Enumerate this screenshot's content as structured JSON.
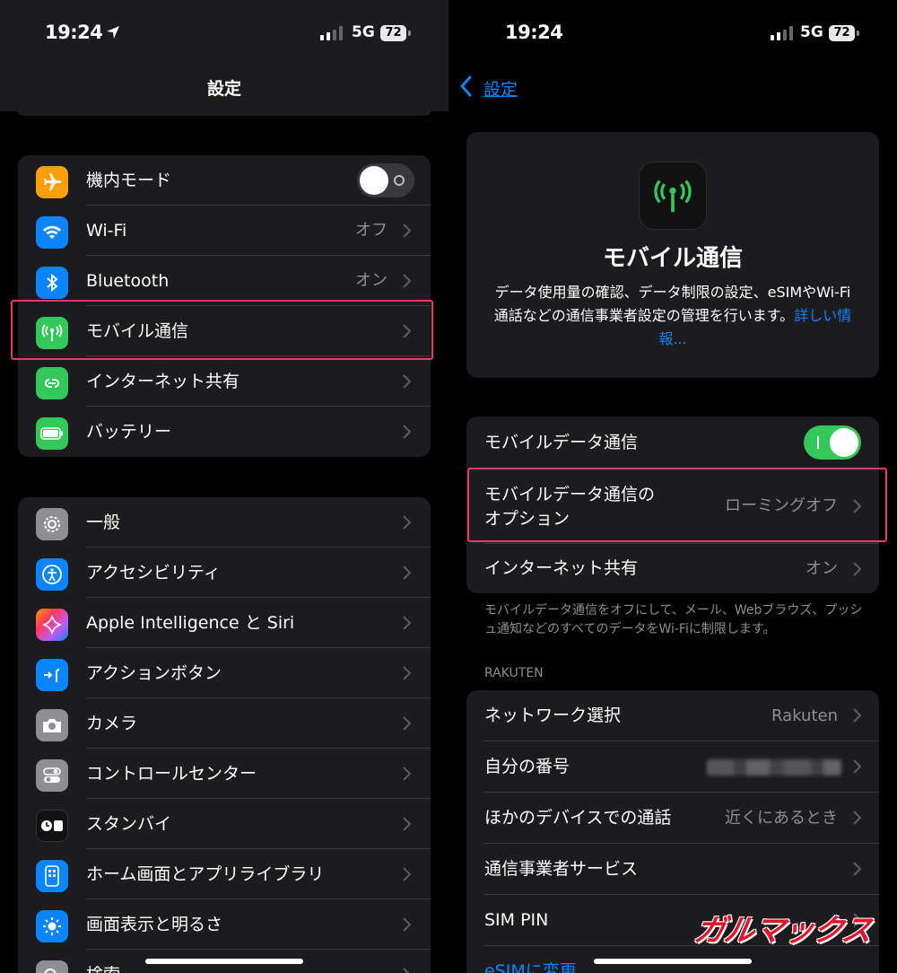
{
  "left": {
    "status": {
      "time": "19:24",
      "network": "5G",
      "battery": "72"
    },
    "nav_title": "設定",
    "group1": [
      {
        "label": "機内モード",
        "icon": "airplane-icon",
        "type": "toggle",
        "on": false
      },
      {
        "label": "Wi-Fi",
        "icon": "wifi-icon",
        "value": "オフ"
      },
      {
        "label": "Bluetooth",
        "icon": "bluetooth-icon",
        "value": "オン"
      },
      {
        "label": "モバイル通信",
        "icon": "antenna-icon",
        "value": ""
      },
      {
        "label": "インターネット共有",
        "icon": "hotspot-icon",
        "value": ""
      },
      {
        "label": "バッテリー",
        "icon": "battery-icon",
        "value": ""
      }
    ],
    "group2": [
      {
        "label": "一般",
        "icon": "gear-icon"
      },
      {
        "label": "アクセシビリティ",
        "icon": "accessibility-icon"
      },
      {
        "label": "Apple Intelligence と Siri",
        "icon": "siri-icon"
      },
      {
        "label": "アクションボタン",
        "icon": "action-button-icon"
      },
      {
        "label": "カメラ",
        "icon": "camera-icon"
      },
      {
        "label": "コントロールセンター",
        "icon": "control-center-icon"
      },
      {
        "label": "スタンバイ",
        "icon": "standby-icon"
      },
      {
        "label": "ホーム画面とアプリライブラリ",
        "icon": "home-screen-icon"
      },
      {
        "label": "画面表示と明るさ",
        "icon": "brightness-icon"
      },
      {
        "label": "検索",
        "icon": "search-icon"
      }
    ],
    "colors": {
      "highlight": "#e8396a",
      "group_bg": "#1c1c1e"
    }
  },
  "right": {
    "status": {
      "time": "19:24",
      "network": "5G",
      "battery": "72"
    },
    "back_label": "設定",
    "hero": {
      "title": "モバイル通信",
      "description": "データ使用量の確認、データ制限の設定、eSIMやWi-Fi通話などの通信事業者設定の管理を行います。",
      "link": "詳しい情報..."
    },
    "group1": {
      "mobile_data": {
        "label": "モバイルデータ通信",
        "on": true
      },
      "options": {
        "label_line1": "モバイルデータ通信の",
        "label_line2": "オプション",
        "value": "ローミングオフ"
      },
      "hotspot": {
        "label": "インターネット共有",
        "value": "オン"
      }
    },
    "footnote": "モバイルデータ通信をオフにして、メール、Webブラウズ、プッシュ通知などのすべてのデータをWi-Fiに制限します。",
    "section_header": "RAKUTEN",
    "group2": [
      {
        "label": "ネットワーク選択",
        "value": "Rakuten"
      },
      {
        "label": "自分の番号",
        "value": ""
      },
      {
        "label": "ほかのデバイスでの通話",
        "value": "近くにあるとき"
      },
      {
        "label": "通信事業者サービス",
        "value": ""
      },
      {
        "label": "SIM PIN",
        "value": ""
      },
      {
        "label": "eSIMに変更",
        "value": ""
      }
    ],
    "watermark": "ガルマックス",
    "colors": {
      "toggle_on": "#34c759",
      "link": "#0a84ff"
    }
  }
}
